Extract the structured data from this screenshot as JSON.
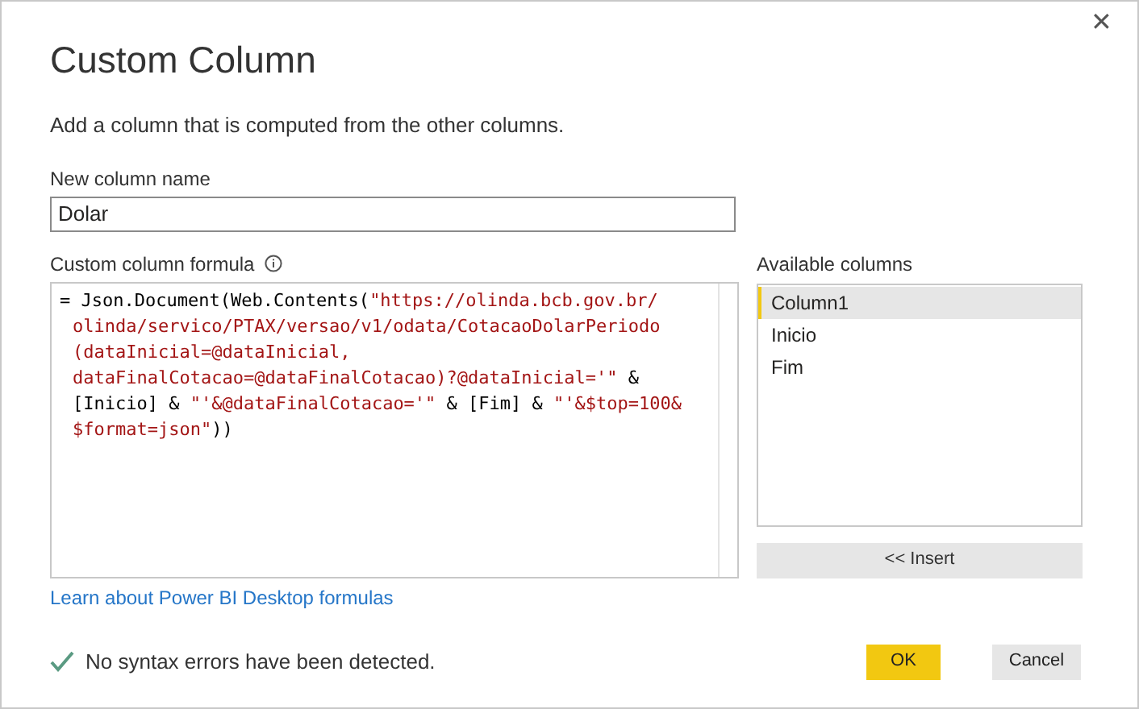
{
  "dialog": {
    "title": "Custom Column",
    "close": "✕",
    "description": "Add a column that is computed from the other columns."
  },
  "name_field": {
    "label": "New column name",
    "value": "Dolar"
  },
  "formula": {
    "label": "Custom column formula",
    "lines": [
      [
        {
          "kind": "code",
          "text": "= Json.Document(Web.Contents("
        },
        {
          "kind": "string",
          "text": "\"https://olinda.bcb.gov.br/"
        }
      ],
      [
        {
          "kind": "string",
          "text": "olinda/servico/PTAX/versao/v1/odata/CotacaoDolarPeriodo"
        }
      ],
      [
        {
          "kind": "string",
          "text": "(dataInicial=@dataInicial,"
        }
      ],
      [
        {
          "kind": "string",
          "text": "dataFinalCotacao=@dataFinalCotacao)?@dataInicial='\""
        },
        {
          "kind": "code",
          "text": " &"
        }
      ],
      [
        {
          "kind": "code",
          "text": "[Inicio] & "
        },
        {
          "kind": "string",
          "text": "\"'&@dataFinalCotacao='\""
        },
        {
          "kind": "code",
          "text": " & [Fim] & "
        },
        {
          "kind": "string",
          "text": "\"'&$top=100&"
        }
      ],
      [
        {
          "kind": "string",
          "text": "$format=json\""
        },
        {
          "kind": "code",
          "text": "))"
        }
      ]
    ]
  },
  "available_columns": {
    "label": "Available columns",
    "items": [
      {
        "label": "Column1",
        "selected": true
      },
      {
        "label": "Inicio",
        "selected": false
      },
      {
        "label": "Fim",
        "selected": false
      }
    ],
    "insert_button": "<< Insert"
  },
  "link": "Learn about Power BI Desktop formulas",
  "status": {
    "ok": true,
    "text": "No syntax errors have been detected."
  },
  "buttons": [
    {
      "label": "OK",
      "kind": "primary"
    },
    {
      "label": "Cancel",
      "kind": "secondary"
    }
  ]
}
